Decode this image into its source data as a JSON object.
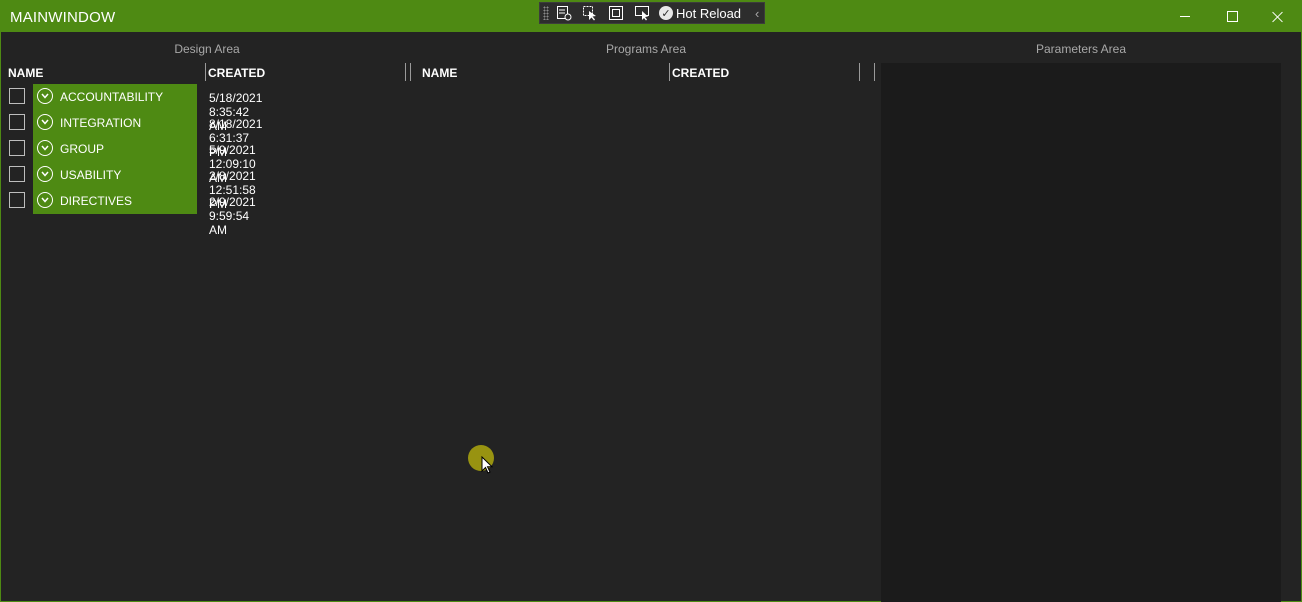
{
  "window": {
    "title": "MAINWINDOW",
    "accent_color": "#4e8a13",
    "controls": [
      "minimize-icon",
      "maximize-icon",
      "close-icon"
    ]
  },
  "dev_toolbar": {
    "tools": [
      "select-element-icon",
      "pointer-icon",
      "layout-adorner-icon",
      "track-focus-icon"
    ],
    "hot_reload_label": "Hot Reload",
    "collapse_glyph": "‹"
  },
  "design_area": {
    "title": "Design Area",
    "columns": {
      "name": "NAME",
      "created": "CREATED"
    },
    "rows": [
      {
        "name": "ACCOUNTABILITY",
        "created": "5/18/2021 8:35:42 AM",
        "checked": false
      },
      {
        "name": "INTEGRATION",
        "created": "8/18/2021 6:31:37 PM",
        "checked": false
      },
      {
        "name": "GROUP",
        "created": "5/9/2021 12:09:10 AM",
        "checked": false
      },
      {
        "name": "USABILITY",
        "created": "2/8/2021 12:51:58 PM",
        "checked": false
      },
      {
        "name": "DIRECTIVES",
        "created": "2/9/2021 9:59:54 AM",
        "checked": false
      }
    ]
  },
  "programs_area": {
    "title": "Programs Area",
    "columns": {
      "name": "NAME",
      "created": "CREATED"
    },
    "rows": []
  },
  "parameters_area": {
    "title": "Parameters Area"
  }
}
